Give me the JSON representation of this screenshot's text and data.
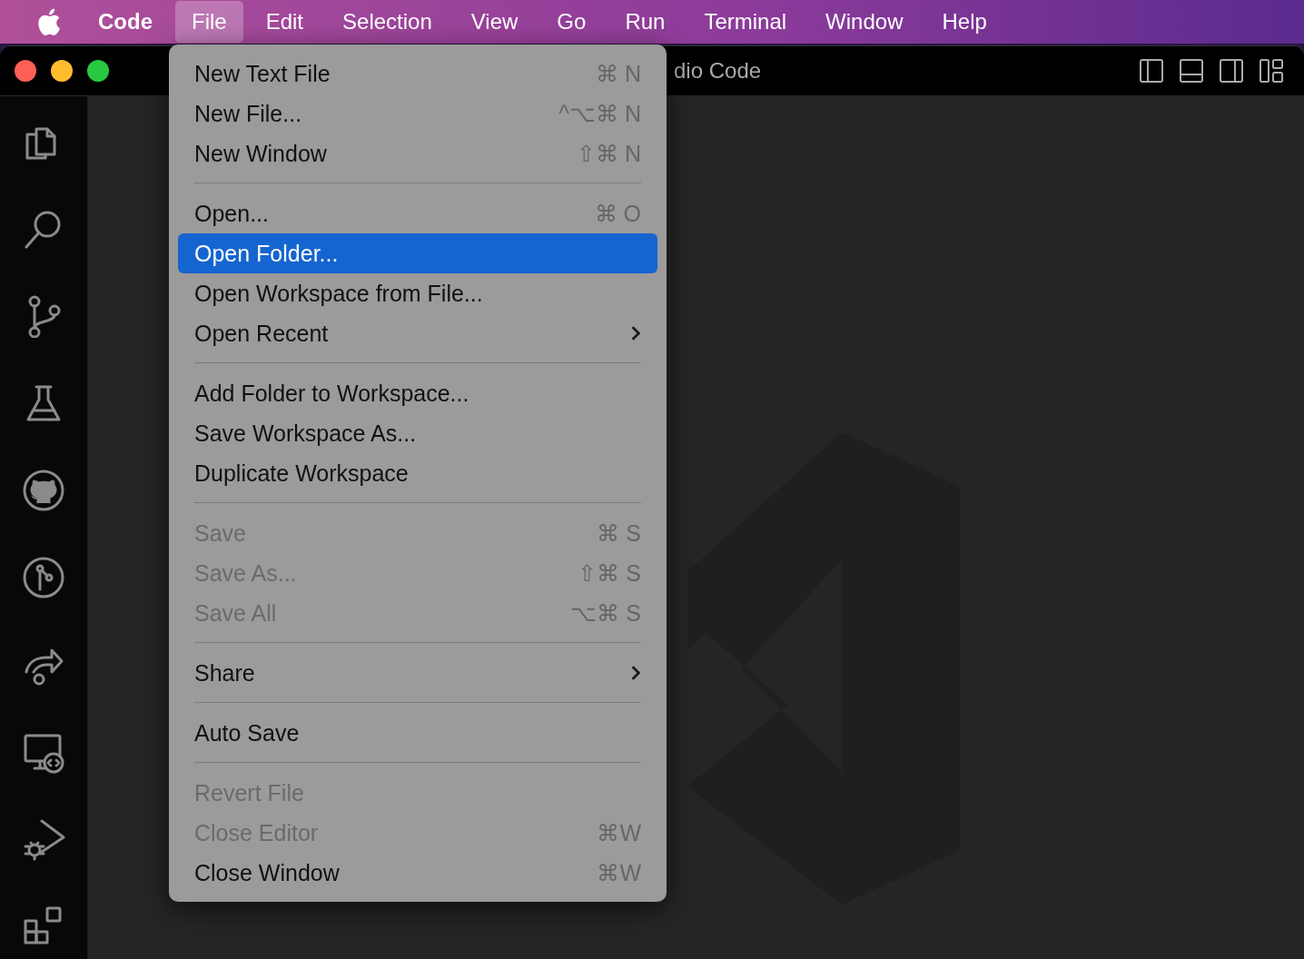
{
  "menu_bar": {
    "items": [
      {
        "label": "Code",
        "bold": true,
        "selected": false
      },
      {
        "label": "File",
        "bold": false,
        "selected": true
      },
      {
        "label": "Edit",
        "bold": false,
        "selected": false
      },
      {
        "label": "Selection",
        "bold": false,
        "selected": false
      },
      {
        "label": "View",
        "bold": false,
        "selected": false
      },
      {
        "label": "Go",
        "bold": false,
        "selected": false
      },
      {
        "label": "Run",
        "bold": false,
        "selected": false
      },
      {
        "label": "Terminal",
        "bold": false,
        "selected": false
      },
      {
        "label": "Window",
        "bold": false,
        "selected": false
      },
      {
        "label": "Help",
        "bold": false,
        "selected": false
      }
    ]
  },
  "window": {
    "title": "dio Code"
  },
  "file_menu": {
    "items": [
      {
        "kind": "item",
        "label": "New Text File",
        "shortcut": "⌘ N",
        "disabled": false,
        "selected": false,
        "submenu": false
      },
      {
        "kind": "item",
        "label": "New File...",
        "shortcut": "^⌥⌘ N",
        "disabled": false,
        "selected": false,
        "submenu": false
      },
      {
        "kind": "item",
        "label": "New Window",
        "shortcut": "⇧⌘ N",
        "disabled": false,
        "selected": false,
        "submenu": false
      },
      {
        "kind": "separator"
      },
      {
        "kind": "item",
        "label": "Open...",
        "shortcut": "⌘ O",
        "disabled": false,
        "selected": false,
        "submenu": false
      },
      {
        "kind": "item",
        "label": "Open Folder...",
        "disabled": false,
        "selected": true,
        "submenu": false
      },
      {
        "kind": "item",
        "label": "Open Workspace from File...",
        "disabled": false,
        "selected": false,
        "submenu": false
      },
      {
        "kind": "item",
        "label": "Open Recent",
        "disabled": false,
        "selected": false,
        "submenu": true
      },
      {
        "kind": "separator"
      },
      {
        "kind": "item",
        "label": "Add Folder to Workspace...",
        "disabled": false,
        "selected": false,
        "submenu": false
      },
      {
        "kind": "item",
        "label": "Save Workspace As...",
        "disabled": false,
        "selected": false,
        "submenu": false
      },
      {
        "kind": "item",
        "label": "Duplicate Workspace",
        "disabled": false,
        "selected": false,
        "submenu": false
      },
      {
        "kind": "separator"
      },
      {
        "kind": "item",
        "label": "Save",
        "shortcut": "⌘ S",
        "disabled": true,
        "selected": false,
        "submenu": false
      },
      {
        "kind": "item",
        "label": "Save As...",
        "shortcut": "⇧⌘ S",
        "disabled": true,
        "selected": false,
        "submenu": false
      },
      {
        "kind": "item",
        "label": "Save All",
        "shortcut": "⌥⌘ S",
        "disabled": true,
        "selected": false,
        "submenu": false
      },
      {
        "kind": "separator"
      },
      {
        "kind": "item",
        "label": "Share",
        "disabled": false,
        "selected": false,
        "submenu": true
      },
      {
        "kind": "separator"
      },
      {
        "kind": "item",
        "label": "Auto Save",
        "disabled": false,
        "selected": false,
        "submenu": false
      },
      {
        "kind": "separator"
      },
      {
        "kind": "item",
        "label": "Revert File",
        "disabled": true,
        "selected": false,
        "submenu": false
      },
      {
        "kind": "item",
        "label": "Close Editor",
        "shortcut": "⌘W",
        "disabled": true,
        "selected": false,
        "submenu": false
      },
      {
        "kind": "item",
        "label": "Close Window",
        "shortcut": "⌘W",
        "disabled": false,
        "selected": false,
        "submenu": false
      }
    ]
  }
}
